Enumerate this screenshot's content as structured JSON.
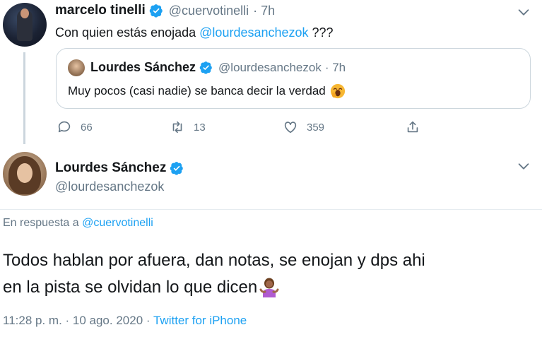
{
  "parent_tweet": {
    "author_name": "marcelo tinelli",
    "author_handle": "@cuervotinelli",
    "time": "· 7h",
    "text_prefix": "Con quien estás enojada ",
    "mention": "@lourdesanchezok",
    "text_suffix": " ???",
    "quoted": {
      "author_name": "Lourdes Sánchez",
      "author_handle": "@lourdesanchezok",
      "time": "· 7h",
      "text": "Muy pocos (casi nadie) se banca decir la verdad",
      "emoji": "yawning-face-emoji"
    },
    "actions": {
      "replies": "66",
      "retweets": "13",
      "likes": "359"
    }
  },
  "main_tweet": {
    "author_name": "Lourdes Sánchez",
    "author_handle": "@lourdesanchezok",
    "reply_prefix": "En respuesta a ",
    "reply_handle": "@cuervotinelli",
    "line1": "Todos hablan por afuera, dan notas, se enojan y dps ahi",
    "line2": "en la pista se olvidan lo que dicen",
    "emoji": "person-shrugging-emoji",
    "timestamp": "11:28 p. m. · 10 ago. 2020 · ",
    "source": "Twitter for iPhone"
  },
  "colors": {
    "accent": "#1da1f2",
    "muted": "#657786",
    "text": "#14171a"
  }
}
